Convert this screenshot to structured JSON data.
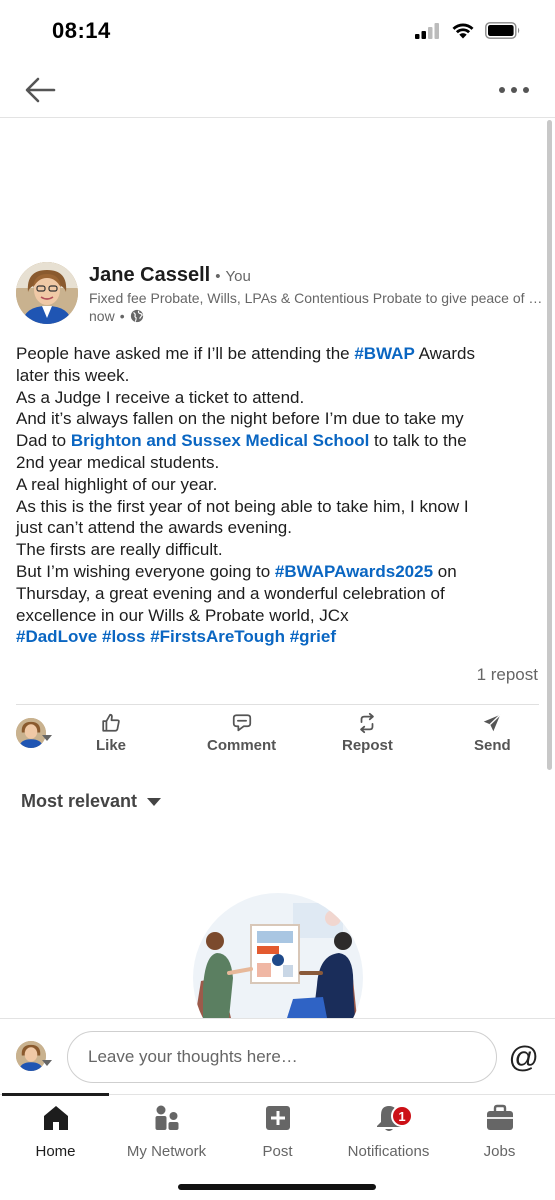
{
  "status_bar": {
    "time": "08:14"
  },
  "post": {
    "author_name": "Jane Cassell",
    "author_relation": "You",
    "headline": "Fixed fee Probate, Wills, LPAs & Contentious Probate to give peace of mind",
    "time": "now",
    "body_lines": [
      [
        {
          "t": "People have asked me if I’ll be attending the "
        },
        {
          "t": "#BWAP",
          "link": true
        },
        {
          "t": " Awards"
        }
      ],
      [
        {
          "t": "later this week."
        }
      ],
      [
        {
          "t": "As a Judge I receive a ticket to attend."
        }
      ],
      [
        {
          "t": "And it’s always fallen on the night before I’m due to take my"
        }
      ],
      [
        {
          "t": "Dad to "
        },
        {
          "t": "Brighton and Sussex Medical School",
          "link": true
        },
        {
          "t": " to talk to the"
        }
      ],
      [
        {
          "t": "2nd year medical students."
        }
      ],
      [
        {
          "t": "A real highlight of our year."
        }
      ],
      [
        {
          "t": "As this is the first year of not being able to take him, I know I"
        }
      ],
      [
        {
          "t": "just can’t attend the awards evening."
        }
      ],
      [
        {
          "t": "The firsts are really difficult."
        }
      ],
      [
        {
          "t": "But I’m wishing everyone going to "
        },
        {
          "t": "#BWAPAwards2025",
          "link": true
        },
        {
          "t": " on"
        }
      ],
      [
        {
          "t": "Thursday, a great evening and a wonderful celebration of"
        }
      ],
      [
        {
          "t": "excellence in our Wills & Probate world, JCx"
        }
      ],
      [
        {
          "t": "#DadLove",
          "link": true
        },
        {
          "t": " "
        },
        {
          "t": "#loss",
          "link": true
        },
        {
          "t": " "
        },
        {
          "t": "#FirstsAreTough",
          "link": true
        },
        {
          "t": " "
        },
        {
          "t": "#grief",
          "link": true
        }
      ]
    ],
    "repost_count": "1 repost"
  },
  "actions": {
    "like": "Like",
    "comment": "Comment",
    "repost": "Repost",
    "send": "Send"
  },
  "comments": {
    "sort_label": "Most relevant"
  },
  "comment_bar": {
    "placeholder": "Leave your thoughts here…",
    "mention_symbol": "@"
  },
  "tabs": [
    {
      "label": "Home",
      "icon": "home-icon",
      "active": true
    },
    {
      "label": "My Network",
      "icon": "network-icon"
    },
    {
      "label": "Post",
      "icon": "post-icon"
    },
    {
      "label": "Notifications",
      "icon": "bell-icon",
      "badge": "1"
    },
    {
      "label": "Jobs",
      "icon": "briefcase-icon"
    }
  ],
  "colors": {
    "link": "#0a66c2",
    "badge": "#cc1016",
    "text": "#1d1d1d",
    "muted": "#666666"
  }
}
